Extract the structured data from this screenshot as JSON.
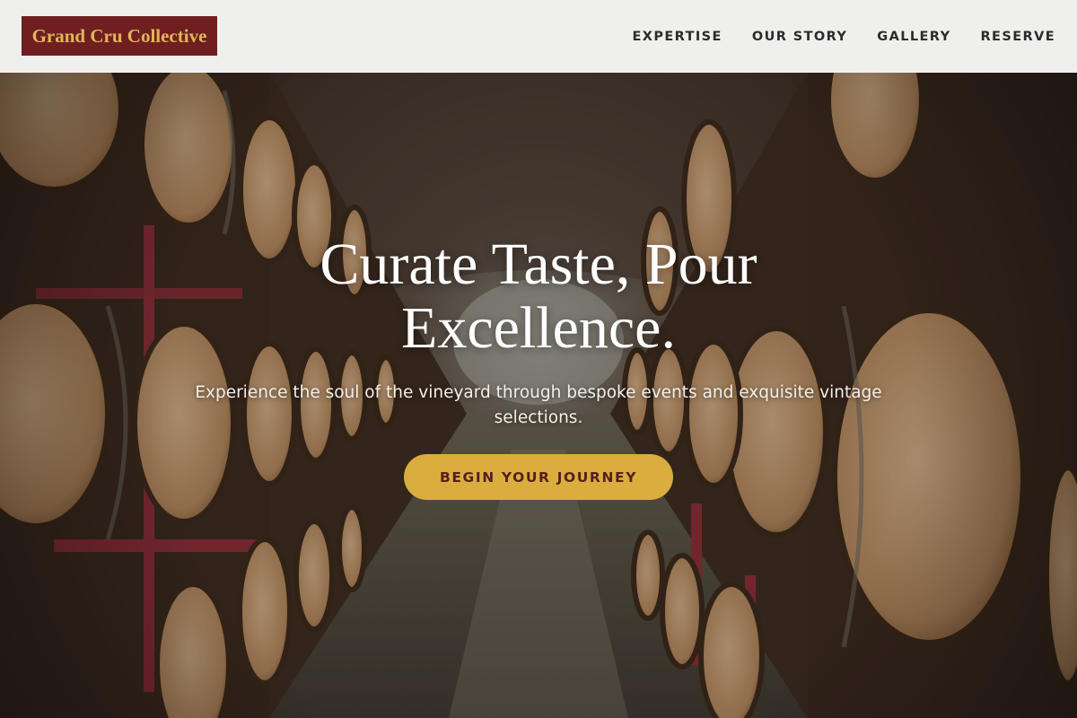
{
  "header": {
    "logo_text": "Grand Cru Collective",
    "nav": [
      {
        "label": "EXPERTISE"
      },
      {
        "label": "OUR STORY"
      },
      {
        "label": "GALLERY"
      },
      {
        "label": "RESERVE"
      }
    ]
  },
  "hero": {
    "title_line1": "Curate Taste, Pour",
    "title_line2": "Excellence.",
    "subtitle": "Experience the soul of the vineyard through bespoke events and exquisite vintage selections.",
    "cta_label": "BEGIN YOUR JOURNEY",
    "background": "wine-cellar-barrels-photo"
  },
  "colors": {
    "logo_bg": "#6f1f1f",
    "logo_text": "#e2b55a",
    "cta_bg": "#d9ae3e",
    "cta_text": "#5a1d1d",
    "header_bg": "#efefed"
  }
}
